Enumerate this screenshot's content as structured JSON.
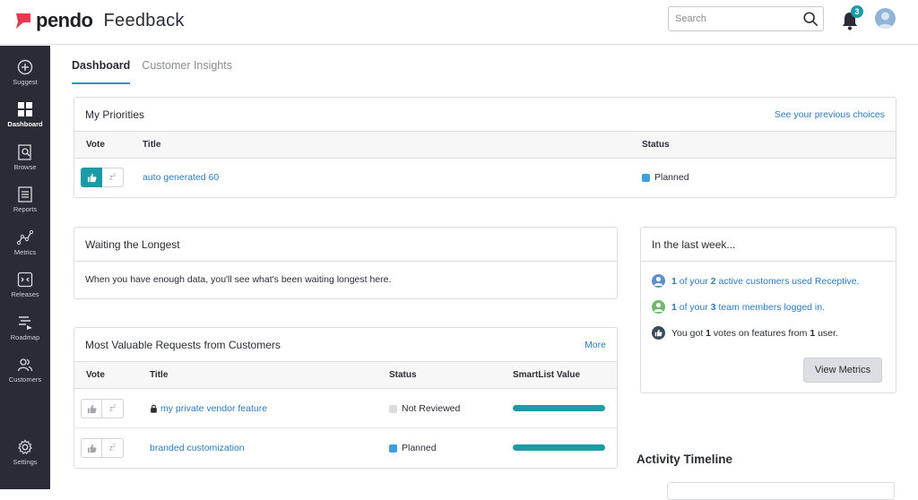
{
  "brand": {
    "logo_text": "pendo",
    "product": "Feedback",
    "logo_color": "#e8384f"
  },
  "header": {
    "search_placeholder": "Search",
    "notification_count": "3"
  },
  "sidebar": {
    "items": [
      {
        "label": "Suggest",
        "icon": "plus-circle-icon"
      },
      {
        "label": "Dashboard",
        "icon": "grid-icon"
      },
      {
        "label": "Browse",
        "icon": "browse-icon"
      },
      {
        "label": "Reports",
        "icon": "reports-icon"
      },
      {
        "label": "Metrics",
        "icon": "metrics-icon"
      },
      {
        "label": "Releases",
        "icon": "releases-icon"
      },
      {
        "label": "Roadmap",
        "icon": "roadmap-icon"
      },
      {
        "label": "Customers",
        "icon": "customers-icon"
      },
      {
        "label": "Settings",
        "icon": "gear-icon"
      }
    ]
  },
  "tabs": [
    {
      "label": "Dashboard"
    },
    {
      "label": "Customer Insights"
    }
  ],
  "priorities": {
    "title": "My Priorities",
    "link": "See your previous choices",
    "headers": {
      "vote": "Vote",
      "title": "Title",
      "status": "Status"
    },
    "rows": [
      {
        "title": "auto generated 60",
        "status": "Planned",
        "status_color": "#3b9fe0"
      }
    ]
  },
  "waiting": {
    "title": "Waiting the Longest",
    "message": "When you have enough data, you'll see what's been waiting longest here."
  },
  "valuable": {
    "title": "Most Valuable Requests from Customers",
    "link": "More",
    "headers": {
      "vote": "Vote",
      "title": "Title",
      "status": "Status",
      "value": "SmartList Value"
    },
    "rows": [
      {
        "title": "my private vendor feature",
        "status": "Not Reviewed",
        "status_color": "#dcdde3",
        "value_pct": 100
      },
      {
        "title": "branded customization",
        "status": "Planned",
        "status_color": "#3b9fe0",
        "value_pct": 100
      }
    ]
  },
  "last_week": {
    "title": "In the last week...",
    "rows": [
      {
        "a": "1",
        "b": " of your ",
        "c": "2",
        "d": " active customers used Receptive."
      },
      {
        "a": "1",
        "b": " of your ",
        "c": "3",
        "d": " team members logged in."
      },
      {
        "a": "You got ",
        "b": "1",
        "c": " votes on features from ",
        "d": "1",
        "e": " user."
      }
    ],
    "button": "View Metrics"
  },
  "timeline": {
    "title": "Activity Timeline"
  },
  "colors": {
    "accent": "#1c9aa6",
    "link": "#2b7bc0",
    "sidebar": "#2a2c35"
  }
}
